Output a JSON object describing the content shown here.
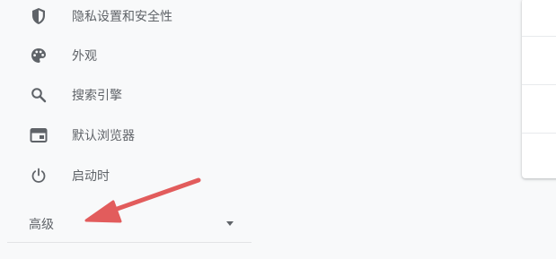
{
  "sidebar": {
    "items": [
      {
        "label": "隐私设置和安全性",
        "icon": "shield-icon"
      },
      {
        "label": "外观",
        "icon": "palette-icon"
      },
      {
        "label": "搜索引擎",
        "icon": "search-icon"
      },
      {
        "label": "默认浏览器",
        "icon": "browser-window-icon"
      },
      {
        "label": "启动时",
        "icon": "power-icon"
      }
    ],
    "advanced": {
      "label": "高级",
      "icon": "caret-down-icon"
    }
  },
  "annotation": {
    "color": "#e25c5c",
    "icon": "red-arrow-annotation"
  },
  "colors": {
    "background": "#f8f9fa",
    "text": "#5f6368",
    "card": "#ffffff"
  }
}
